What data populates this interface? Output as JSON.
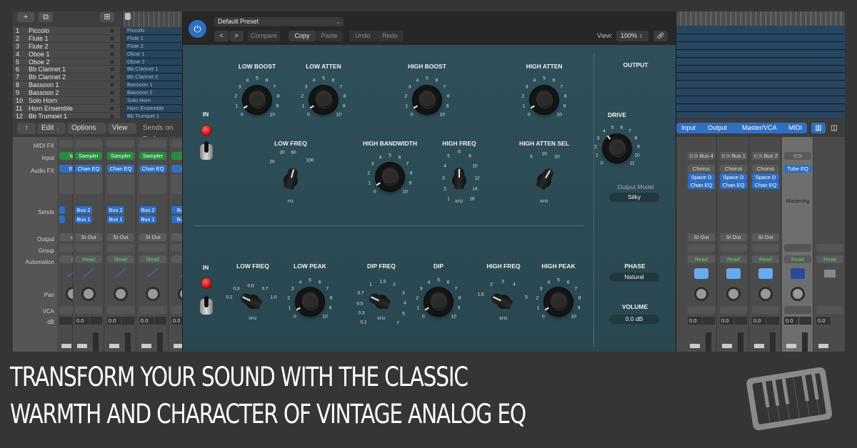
{
  "tracks": {
    "toolbar": {
      "add_label": "+",
      "duplicate_icon": "duplicate-icon",
      "folder_icon": "folder-icon"
    },
    "rows": [
      {
        "num": "1",
        "name": "Piccolo"
      },
      {
        "num": "2",
        "name": "Flute 1"
      },
      {
        "num": "3",
        "name": "Flute 2"
      },
      {
        "num": "4",
        "name": "Oboe 1"
      },
      {
        "num": "5",
        "name": "Oboe 2"
      },
      {
        "num": "6",
        "name": "Bb Clarinet 1"
      },
      {
        "num": "7",
        "name": "Bb Clarinet 2"
      },
      {
        "num": "8",
        "name": "Bassoon 1"
      },
      {
        "num": "9",
        "name": "Bassoon 2"
      },
      {
        "num": "10",
        "name": "Solo Horn"
      },
      {
        "num": "11",
        "name": "Horn Ensemble"
      },
      {
        "num": "12",
        "name": "Bb Trumpet 1"
      }
    ]
  },
  "mixer": {
    "toolbar": {
      "up_icon": "↑",
      "edit": "Edit",
      "options": "Options",
      "view": "View",
      "sends_on_faders": "Sends on Fad"
    },
    "tabs": [
      "Input",
      "Output",
      "Master/VCA",
      "MIDI"
    ],
    "row_labels": {
      "midi_fx": "MIDI FX",
      "input": "Input",
      "audio_fx": "Audio FX",
      "sends": "Sends",
      "output": "Output",
      "group": "Group",
      "automation": "Automation",
      "pan": "Pan",
      "vca": "VCA",
      "db": "dB"
    },
    "left_strips": [
      {
        "input": "ler",
        "audio_fx": "EQ",
        "send1": "",
        "send2": "",
        "output": "ut",
        "automation": "d",
        "db": ""
      },
      {
        "input": "Sampler",
        "audio_fx": "Chan EQ",
        "send1": "Bus 2",
        "send2": "Bus 1",
        "output": "St Out",
        "automation": "Read",
        "db": "0.0"
      },
      {
        "input": "Sampler",
        "audio_fx": "Chan EQ",
        "send1": "Bus 2",
        "send2": "Bus 1",
        "output": "St Out",
        "automation": "Read",
        "db": "0.0"
      },
      {
        "input": "Sampler",
        "audio_fx": "Chan EQ",
        "send1": "Bus 2",
        "send2": "Bus 1",
        "output": "St Out",
        "automation": "Read",
        "db": "0.0"
      },
      {
        "input": "Sa",
        "audio_fx": "Ch",
        "send1": "Bu",
        "send2": "Bu",
        "output": "St",
        "automation": "R",
        "db": "0.0"
      }
    ],
    "right_strips": [
      {
        "input": "Bus 4",
        "fx": [
          "Chorus",
          "Space D",
          "Chan EQ"
        ],
        "output": "St Out",
        "automation": "Read",
        "db": "0.0"
      },
      {
        "input": "Bus 1",
        "fx": [
          "Chorus",
          "Space D",
          "Chan EQ"
        ],
        "output": "St Out",
        "automation": "Read",
        "db": "0.0"
      },
      {
        "input": "Bus 2",
        "fx": [
          "Chorus",
          "Space D",
          "Chan EQ"
        ],
        "output": "St Out",
        "automation": "Read",
        "db": "0.0"
      },
      {
        "input": "",
        "fx": [
          "Tube EQ"
        ],
        "label": "Mastering",
        "output": "",
        "automation": "Read",
        "db": "0.0"
      },
      {
        "input": "",
        "fx": [],
        "output": "",
        "automation": "Read",
        "db": "0.0"
      }
    ]
  },
  "plugin": {
    "preset": "Default Preset",
    "header_buttons": {
      "prev": "<",
      "next": ">",
      "compare": "Compare",
      "copy": "Copy",
      "paste": "Paste",
      "undo": "Undo",
      "redo": "Redo"
    },
    "view_label": "View:",
    "zoom": "100%",
    "accent": "#2f6fc2",
    "panel_color": "#2b4a55",
    "top": {
      "in_label": "IN",
      "low_boost": {
        "title": "LOW BOOST",
        "value": 0.5,
        "ticks": [
          "0",
          "1",
          "2",
          "3",
          "4",
          "5",
          "6",
          "7",
          "8",
          "9",
          "10"
        ]
      },
      "low_atten": {
        "title": "LOW ATTEN",
        "value": 0.5,
        "ticks": [
          "0",
          "1",
          "2",
          "3",
          "4",
          "5",
          "6",
          "7",
          "8",
          "9",
          "10"
        ]
      },
      "high_boost": {
        "title": "HIGH BOOST",
        "value": 0.5,
        "ticks": [
          "0",
          "1",
          "2",
          "3",
          "4",
          "5",
          "6",
          "7",
          "8",
          "9",
          "10"
        ]
      },
      "high_atten": {
        "title": "HIGH ATTEN",
        "value": 0.5,
        "ticks": [
          "0",
          "1",
          "2",
          "3",
          "4",
          "5",
          "6",
          "7",
          "8",
          "9",
          "10"
        ]
      },
      "low_freq": {
        "title": "LOW FREQ",
        "unit": "Hz",
        "ticks": [
          "20",
          "30",
          "60",
          "100"
        ],
        "selected": "60"
      },
      "high_bandwidth": {
        "title": "HIGH BANDWIDTH",
        "value": 0.5,
        "ticks": [
          "0",
          "1",
          "2",
          "3",
          "4",
          "5",
          "6",
          "7",
          "8",
          "9",
          "10"
        ]
      },
      "high_freq": {
        "title": "HIGH FREQ",
        "unit": "kHz",
        "ticks": [
          "1",
          "2",
          "3",
          "4",
          "5",
          "6",
          "8",
          "10",
          "12",
          "14",
          "16"
        ],
        "selected": "6"
      },
      "high_atten_sel": {
        "title": "HIGH ATTEN SEL",
        "unit": "kHz",
        "ticks": [
          "5",
          "10",
          "20"
        ],
        "selected": "20"
      }
    },
    "output": {
      "title": "OUTPUT",
      "drive": {
        "title": "DRIVE",
        "value": 4,
        "ticks": [
          "0",
          "1",
          "2",
          "3",
          "4",
          "5",
          "6",
          "7",
          "8",
          "9",
          "10",
          "11"
        ]
      },
      "output_model_label": "Output Model",
      "output_model": "Silky",
      "phase_label": "PHASE",
      "phase": "Natural",
      "volume_label": "VOLUME",
      "volume": "0.0 dB"
    },
    "bottom": {
      "in_label": "IN",
      "low_freq": {
        "title": "LOW FREQ",
        "unit": "kHz",
        "ticks": [
          "0.2",
          "0.3",
          "0.5",
          "0.7",
          "1.0"
        ],
        "selected": "0.2"
      },
      "low_peak": {
        "title": "LOW PEAK",
        "value": 0.5,
        "ticks": [
          "0",
          "1",
          "2",
          "3",
          "4",
          "5",
          "6",
          "7",
          "8",
          "9",
          "10"
        ]
      },
      "dip_freq": {
        "title": "DIP FREQ",
        "unit": "kHz",
        "ticks": [
          "0.2",
          "0.3",
          "0.5",
          "0.7",
          "1",
          "1.5",
          "2",
          "3",
          "4",
          "5",
          "7"
        ],
        "selected": "0.7"
      },
      "dip": {
        "title": "DIP",
        "value": 0.5,
        "ticks": [
          "0",
          "1",
          "2",
          "3",
          "4",
          "5",
          "6",
          "7",
          "8",
          "9",
          "10"
        ]
      },
      "high_freq": {
        "title": "HIGH FREQ",
        "unit": "kHz",
        "ticks": [
          "1.5",
          "2",
          "3",
          "4",
          "5"
        ],
        "selected": "1.5"
      },
      "high_peak": {
        "title": "HIGH PEAK",
        "value": 0.5,
        "ticks": [
          "0",
          "1",
          "2",
          "3",
          "4",
          "5",
          "6",
          "7",
          "8",
          "9",
          "10"
        ]
      }
    }
  },
  "banner": {
    "line1": "TRANSFORM YOUR SOUND WITH THE CLASSIC",
    "line2": "WARMTH AND CHARACTER OF VINTAGE ANALOG EQ",
    "logo_icon": "piano-keyboard-icon"
  }
}
